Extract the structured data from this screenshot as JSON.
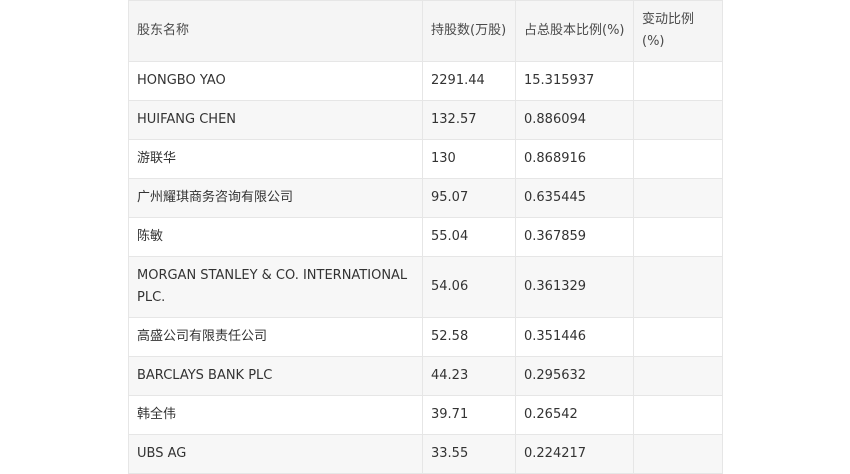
{
  "table": {
    "headers": [
      "股东名称",
      "持股数(万股)",
      "占总股本比例(%)",
      "变动比例(%)"
    ],
    "rows": [
      {
        "name": "HONGBO YAO",
        "shares": "2291.44",
        "ratio": "15.315937",
        "change": ""
      },
      {
        "name": "HUIFANG CHEN",
        "shares": "132.57",
        "ratio": "0.886094",
        "change": ""
      },
      {
        "name": "游联华",
        "shares": "130",
        "ratio": "0.868916",
        "change": ""
      },
      {
        "name": "广州耀琪商务咨询有限公司",
        "shares": "95.07",
        "ratio": "0.635445",
        "change": ""
      },
      {
        "name": "陈敏",
        "shares": "55.04",
        "ratio": "0.367859",
        "change": ""
      },
      {
        "name": "MORGAN STANLEY & CO. INTERNATIONAL PLC.",
        "shares": "54.06",
        "ratio": "0.361329",
        "change": ""
      },
      {
        "name": "高盛公司有限责任公司",
        "shares": "52.58",
        "ratio": "0.351446",
        "change": ""
      },
      {
        "name": "BARCLAYS BANK PLC",
        "shares": "44.23",
        "ratio": "0.295632",
        "change": ""
      },
      {
        "name": "韩全伟",
        "shares": "39.71",
        "ratio": "0.26542",
        "change": ""
      },
      {
        "name": "UBS AG",
        "shares": "33.55",
        "ratio": "0.224217",
        "change": ""
      }
    ]
  }
}
